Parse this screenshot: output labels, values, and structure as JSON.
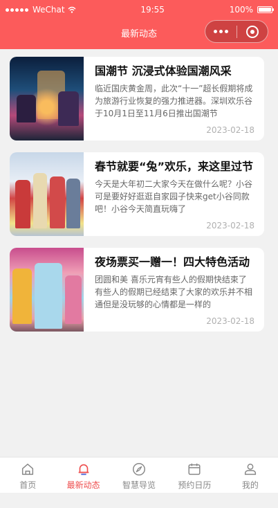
{
  "status_bar": {
    "carrier": "WeChat",
    "time": "19:55",
    "battery": "100%"
  },
  "nav": {
    "title": "最新动态"
  },
  "articles": [
    {
      "title": "国潮节 沉浸式体验国潮风采",
      "desc": "临近国庆黄金周，此次“十一”超长假期将成为旅游行业恢复的强力推进器。深圳欢乐谷于10月1日至11月6日推出国潮节",
      "date": "2023-02-18"
    },
    {
      "title": "春节就要“兔”欢乐，来这里过节",
      "desc": "今天是大年初二大家今天在做什么呢？小谷可是要好好逛逛自家园子快来get小谷同款吧！小谷今天简直玩嗨了",
      "date": "2023-02-18"
    },
    {
      "title": "夜场票买一赠一！四大特色活动",
      "desc": "团圆和美 喜乐元宵有些人的假期快结束了有些人的假期已经结束了大家的欢乐并不相通但是没玩够的心情都是一样的",
      "date": "2023-02-18"
    }
  ],
  "tabbar": {
    "items": [
      {
        "label": "首页",
        "icon": "home-icon"
      },
      {
        "label": "最新动态",
        "icon": "bell-icon"
      },
      {
        "label": "智慧导览",
        "icon": "compass-icon"
      },
      {
        "label": "预约日历",
        "icon": "calendar-icon"
      },
      {
        "label": "我的",
        "icon": "user-icon"
      }
    ],
    "active_index": 1
  },
  "colors": {
    "accent": "#fc5b5b",
    "active_tab": "#ee4c4c",
    "background": "#f1f1f1"
  }
}
